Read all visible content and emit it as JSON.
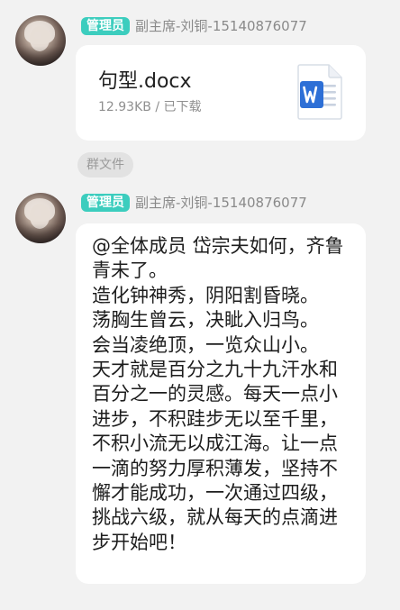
{
  "messages": [
    {
      "sender": {
        "role": "管理员",
        "name": "副主席-刘铜-15140876077"
      },
      "file": {
        "name": "句型.docx",
        "meta": "12.93KB / 已下载",
        "icon": "word-doc-icon",
        "icon_color": "#2d6fd6"
      }
    },
    {
      "sender": {
        "role": "管理员",
        "name": "副主席-刘铜-15140876077"
      },
      "text": "@全体成员 岱宗夫如何，齐鲁青未了。\n造化钟神秀，阴阳割昏晓。\n荡胸生曾云，决眦入归鸟。\n会当凌绝顶，一览众山小。\n天才就是百分之九十九汗水和百分之一的灵感。每天一点小进步，不积跬步无以至千里，不积小流无以成江海。让一点一滴的努力厚积薄发，坚持不懈才能成功，一次通过四级，挑战六级，就从每天的点滴进步开始吧！"
    }
  ],
  "source_tag": "群文件",
  "colors": {
    "background": "#f2f2f2",
    "badge": "#3ccdbe",
    "bubble": "#ffffff",
    "source_tag": "#e2e2e2"
  }
}
